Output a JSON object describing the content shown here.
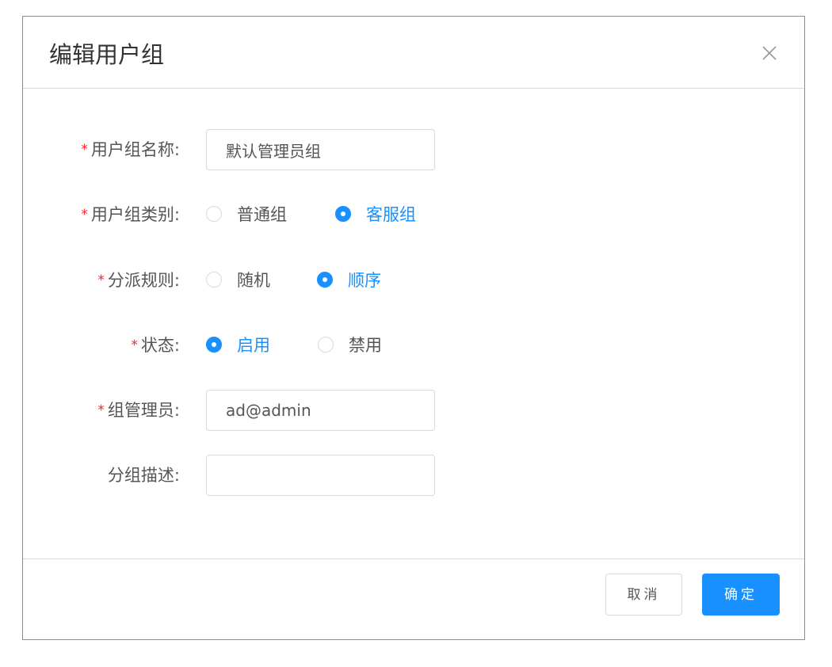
{
  "dialog": {
    "title": "编辑用户组",
    "close_icon": "close-icon"
  },
  "form": {
    "required_mark": "*",
    "group_name": {
      "label": "用户组名称:",
      "value": "默认管理员组",
      "required": true
    },
    "group_type": {
      "label": "用户组类别:",
      "required": true,
      "options": [
        "普通组",
        "客服组"
      ],
      "selected": "客服组"
    },
    "dispatch_rule": {
      "label": "分派规则:",
      "required": true,
      "options": [
        "随机",
        "顺序"
      ],
      "selected": "顺序"
    },
    "status": {
      "label": "状态:",
      "required": true,
      "options": [
        "启用",
        "禁用"
      ],
      "selected": "启用"
    },
    "group_admin": {
      "label": "组管理员:",
      "value": "ad@admin",
      "required": true
    },
    "group_desc": {
      "label": "分组描述:",
      "value": "",
      "required": false
    }
  },
  "footer": {
    "cancel_label": "取消",
    "ok_label": "确定"
  },
  "colors": {
    "primary": "#1890ff",
    "required": "#f5222d",
    "border": "#d9d9d9",
    "text": "#555555"
  }
}
